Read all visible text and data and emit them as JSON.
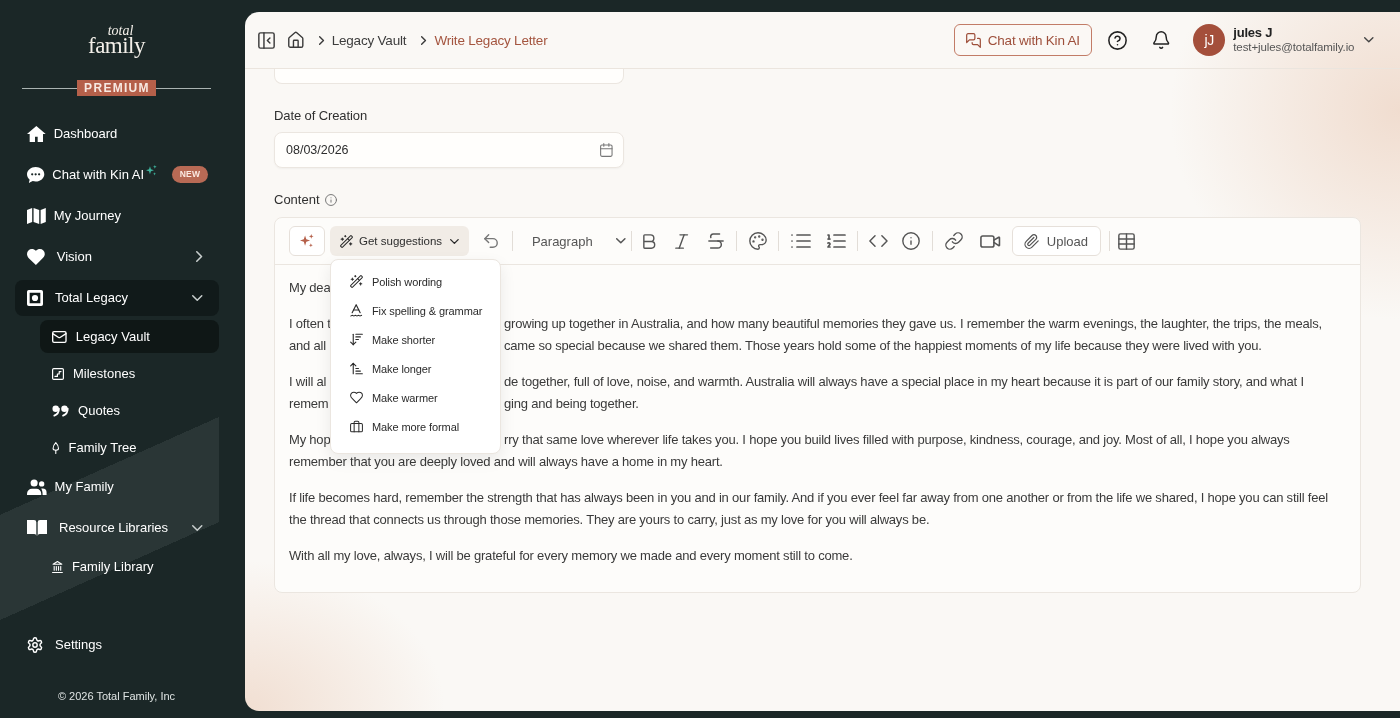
{
  "sidebar": {
    "logo": {
      "small_word": "total",
      "large_word": "family"
    },
    "plan_badge": "PREMIUM",
    "nav": [
      {
        "label": "Dashboard",
        "selected": false
      },
      {
        "label": "Chat with Kin AI",
        "badge": "NEW",
        "selected": false
      },
      {
        "label": "My Journey",
        "selected": false
      },
      {
        "label": "Vision",
        "selected": false,
        "expanded": false
      },
      {
        "label": "Total Legacy",
        "selected": true,
        "expanded": true,
        "children": [
          {
            "label": "Legacy Vault",
            "selected": true
          },
          {
            "label": "Milestones",
            "selected": false
          },
          {
            "label": "Quotes",
            "selected": false
          },
          {
            "label": "Family Tree",
            "selected": false
          }
        ]
      },
      {
        "label": "My Family",
        "selected": false
      },
      {
        "label": "Resource Libraries",
        "selected": false,
        "expanded": true,
        "children": [
          {
            "label": "Family Library",
            "selected": false
          }
        ]
      }
    ],
    "settings": {
      "label": "Settings",
      "selected": false
    },
    "footer": "© 2026 Total Family, Inc"
  },
  "header": {
    "breadcrumbs": [
      {
        "label": "Legacy Vault",
        "current": false
      },
      {
        "label": "Write Legacy Letter",
        "current": true
      }
    ],
    "chat_button": "Chat with Kin AI",
    "user": {
      "initials": "jJ",
      "name": "jules J",
      "email": "test+jules@totalfamily.io"
    }
  },
  "form": {
    "date_field": {
      "label": "Date of Creation",
      "value": "08/03/2026"
    },
    "content": {
      "label": "Content",
      "toolbar": {
        "suggestions": {
          "label": "Get suggestions",
          "expanded": true
        },
        "block_type": "Paragraph",
        "upload": "Upload"
      },
      "suggestions_menu": [
        {
          "label": "Polish wording"
        },
        {
          "label": "Fix spelling & grammar"
        },
        {
          "label": "Make shorter"
        },
        {
          "label": "Make longer"
        },
        {
          "label": "Make warmer"
        },
        {
          "label": "Make more formal"
        }
      ],
      "paragraphs": [
        {
          "kind": "partly_covered",
          "lines": [
            {
              "before": "My dea"
            }
          ]
        },
        {
          "kind": "partly_covered",
          "lines": [
            {
              "before": "I often t",
              "after": "growing up together in Australia, and how many beautiful memories they gave us. I remember the warm evenings, the laughter, the trips, the meals,"
            },
            {
              "before": "and all",
              "after": "came so special because we shared them. Those years hold some of the happiest moments of my life because they were lived with you."
            }
          ]
        },
        {
          "kind": "partly_covered",
          "lines": [
            {
              "before": "I will al",
              "after": "de together, full of love, noise, and warmth. Australia will always have a special place in my heart because it is part of our family story, and what I"
            },
            {
              "before": "remem",
              "after": "ging and being together."
            }
          ]
        },
        {
          "kind": "partly_covered",
          "lines": [
            {
              "before": "My hop",
              "after": "rry that same love wherever life takes you. I hope you build lives filled with purpose, kindness, courage, and joy. Most of all, I hope you always"
            },
            {
              "before": "remember that you are deeply loved and will always have a home in my heart."
            }
          ]
        },
        {
          "kind": "full",
          "text": "If life becomes hard, remember the strength that has always been in you and in our family. And if you ever feel far away from one another or from the life we shared, I hope you can still feel the thread that connects us through those memories. They are yours to carry, just as my love for you will always be."
        },
        {
          "kind": "full",
          "text": "With all my love, always, I will be grateful for every memory we made and every moment still to come."
        }
      ]
    }
  }
}
